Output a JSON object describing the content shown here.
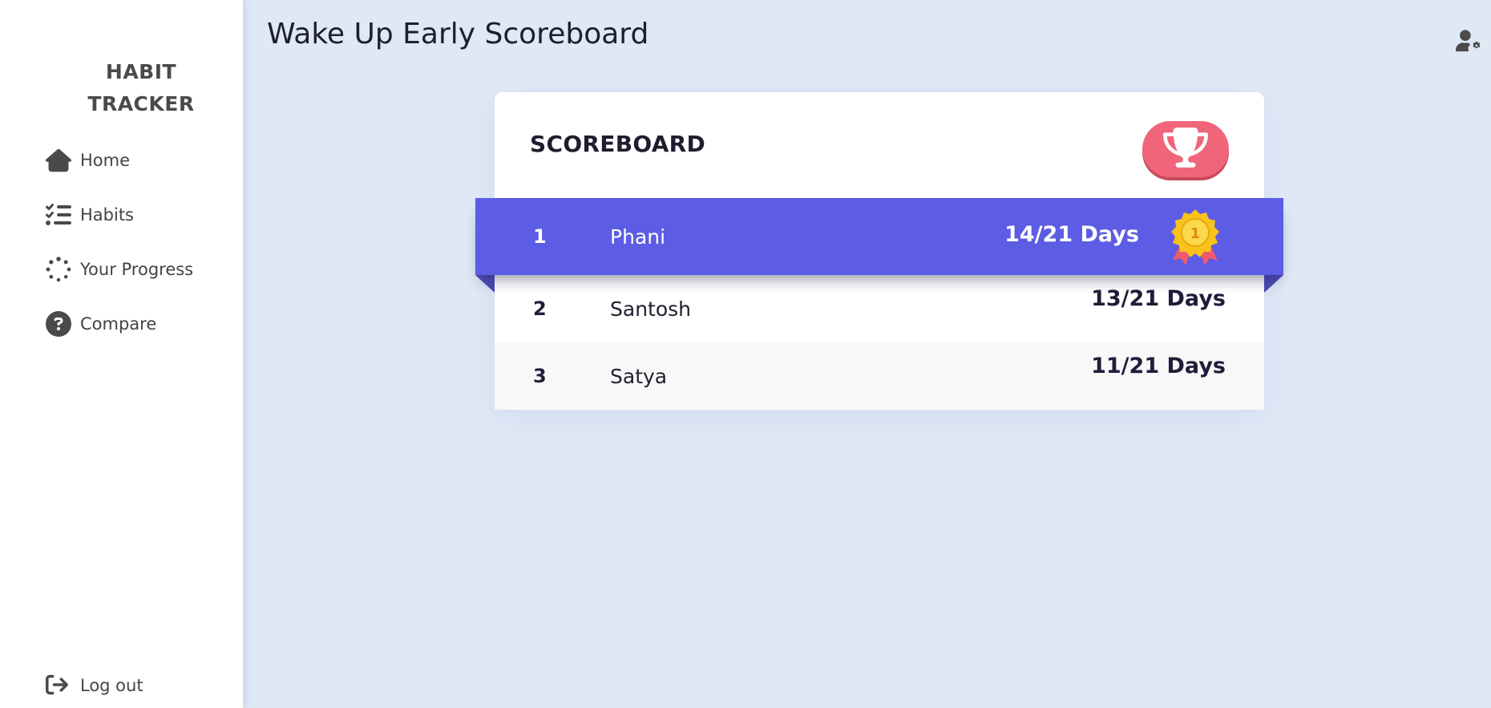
{
  "sidebar": {
    "brand_line1": "HABIT",
    "brand_line2": "TRACKER",
    "items": [
      {
        "label": "Home",
        "icon": "home-icon"
      },
      {
        "label": "Habits",
        "icon": "list-check-icon"
      },
      {
        "label": "Your Progress",
        "icon": "spinner-icon"
      },
      {
        "label": "Compare",
        "icon": "question-circle-icon"
      }
    ],
    "logout_label": "Log out"
  },
  "header": {
    "title": "Wake Up Early Scoreboard",
    "settings_icon": "user-gear-icon"
  },
  "scoreboard": {
    "heading": "SCOREBOARD",
    "trophy_icon": "trophy-icon",
    "rows": [
      {
        "rank": "1",
        "name": "Phani",
        "days": "14/21 Days",
        "badge": "first-place-medal-icon"
      },
      {
        "rank": "2",
        "name": "Santosh",
        "days": "13/21 Days"
      },
      {
        "rank": "3",
        "name": "Satya",
        "days": "11/21 Days"
      }
    ]
  },
  "colors": {
    "background": "#dfe8f5",
    "accent": "#5c5ce4",
    "trophy": "#f0657a"
  }
}
